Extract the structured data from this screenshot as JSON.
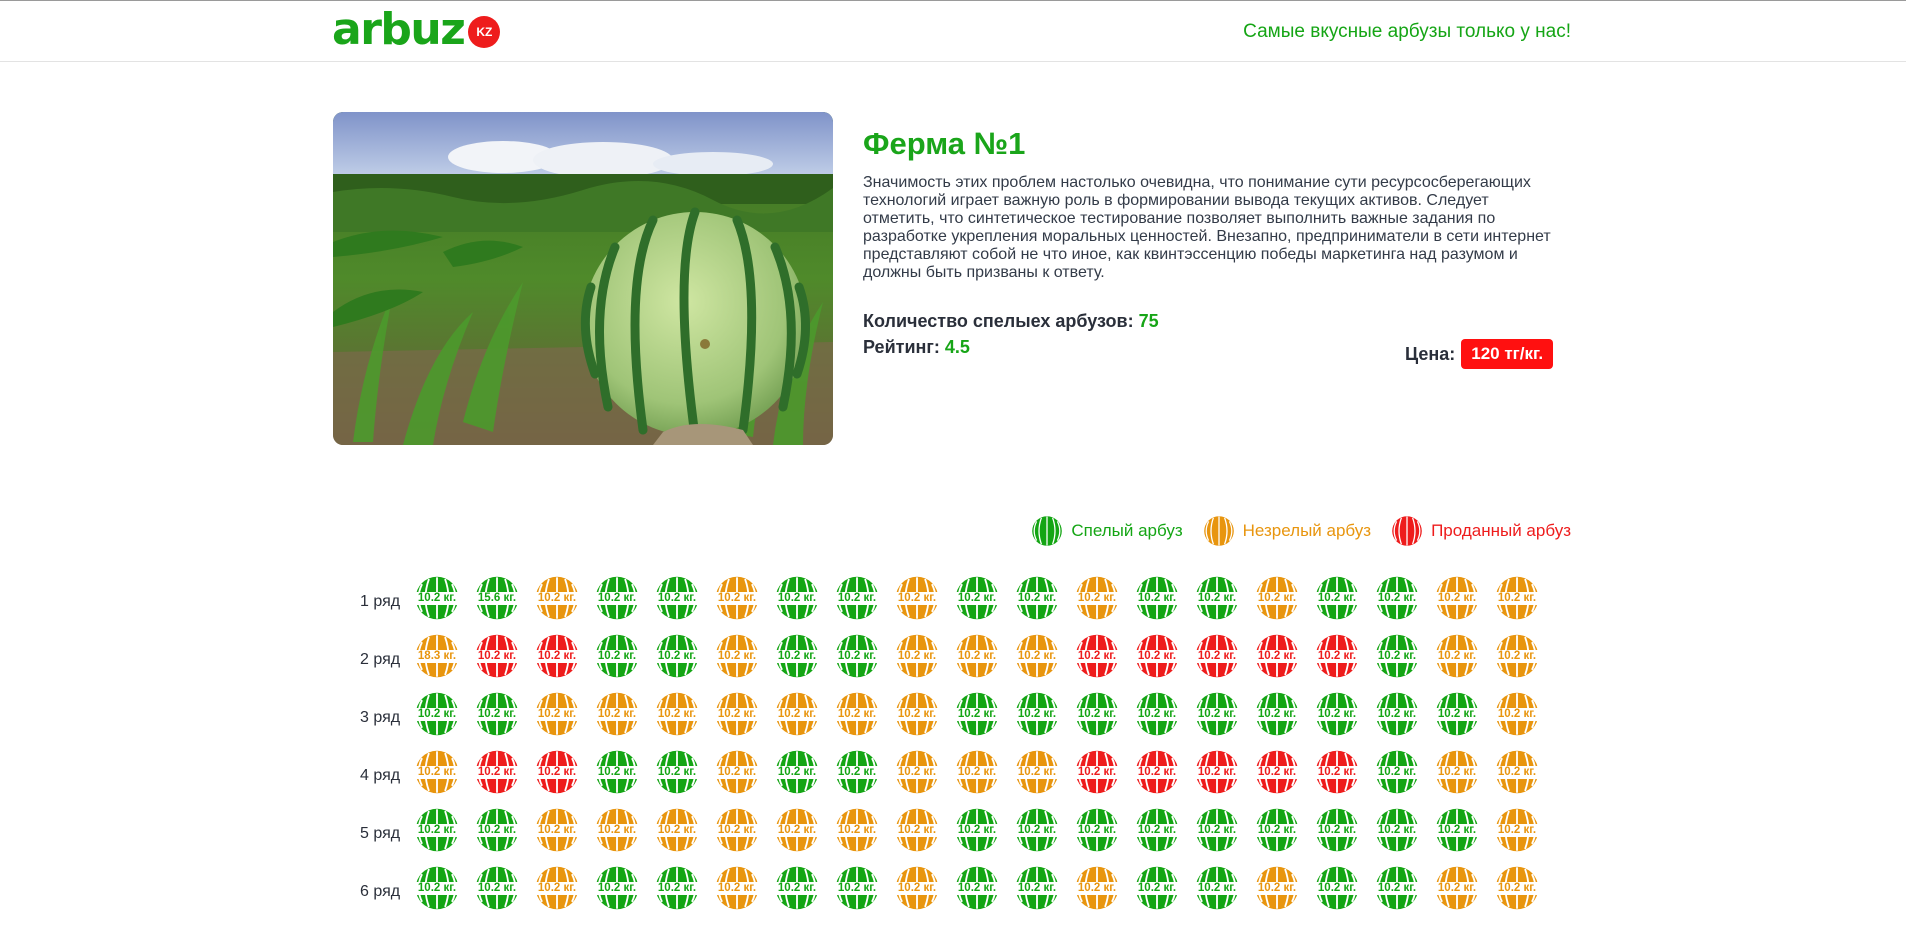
{
  "header": {
    "logo_text": "arbuz",
    "logo_badge": "KZ",
    "tagline": "Самые вкусные арбузы только у нас!"
  },
  "farm": {
    "title": "Ферма №1",
    "description": "Значимость этих проблем настолько очевидна, что понимание сути ресурсосберегающих технологий играет важную роль в формировании вывода текущих активов. Следует отметить, что синтетическое тестирование позволяет выполнить важные задания по разработке укрепления моральных ценностей. Внезапно, предприниматели в сети интернет представляют собой не что иное, как квинтэссенцию победы маркетинга над разумом и должны быть призваны к ответу.",
    "ripe_label": "Количество спелыех арбузов:",
    "ripe_value": "75",
    "rating_label": "Рейтинг:",
    "rating_value": "4.5",
    "price_label": "Цена:",
    "price_value": "120 тг/кг."
  },
  "colors": {
    "ripe": "#14a514",
    "unripe": "#e8950e",
    "sold": "#ee1c1c"
  },
  "legend": [
    {
      "status": "ripe",
      "label": "Спелый арбуз"
    },
    {
      "status": "unripe",
      "label": "Незрелый арбуз"
    },
    {
      "status": "sold",
      "label": "Проданный арбуз"
    }
  ],
  "field": {
    "rows": [
      {
        "label": "1 ряд",
        "cells": [
          {
            "w": "10.2 кг.",
            "s": "ripe"
          },
          {
            "w": "15.6 кг.",
            "s": "ripe"
          },
          {
            "w": "10.2 кг.",
            "s": "unripe"
          },
          {
            "w": "10.2 кг.",
            "s": "ripe"
          },
          {
            "w": "10.2 кг.",
            "s": "ripe"
          },
          {
            "w": "10.2 кг.",
            "s": "unripe"
          },
          {
            "w": "10.2 кг.",
            "s": "ripe"
          },
          {
            "w": "10.2 кг.",
            "s": "ripe"
          },
          {
            "w": "10.2 кг.",
            "s": "unripe"
          },
          {
            "w": "10.2 кг.",
            "s": "ripe"
          },
          {
            "w": "10.2 кг.",
            "s": "ripe"
          },
          {
            "w": "10.2 кг.",
            "s": "unripe"
          },
          {
            "w": "10.2 кг.",
            "s": "ripe"
          },
          {
            "w": "10.2 кг.",
            "s": "ripe"
          },
          {
            "w": "10.2 кг.",
            "s": "unripe"
          },
          {
            "w": "10.2 кг.",
            "s": "ripe"
          },
          {
            "w": "10.2 кг.",
            "s": "ripe"
          },
          {
            "w": "10.2 кг.",
            "s": "unripe"
          },
          {
            "w": "10.2 кг.",
            "s": "unripe"
          }
        ]
      },
      {
        "label": "2 ряд",
        "cells": [
          {
            "w": "18.3 кг.",
            "s": "unripe"
          },
          {
            "w": "10.2 кг.",
            "s": "sold"
          },
          {
            "w": "10.2 кг.",
            "s": "sold"
          },
          {
            "w": "10.2 кг.",
            "s": "ripe"
          },
          {
            "w": "10.2 кг.",
            "s": "ripe"
          },
          {
            "w": "10.2 кг.",
            "s": "unripe"
          },
          {
            "w": "10.2 кг.",
            "s": "ripe"
          },
          {
            "w": "10.2 кг.",
            "s": "ripe"
          },
          {
            "w": "10.2 кг.",
            "s": "unripe"
          },
          {
            "w": "10.2 кг.",
            "s": "unripe"
          },
          {
            "w": "10.2 кг.",
            "s": "unripe"
          },
          {
            "w": "10.2 кг.",
            "s": "sold"
          },
          {
            "w": "10.2 кг.",
            "s": "sold"
          },
          {
            "w": "10.2 кг.",
            "s": "sold"
          },
          {
            "w": "10.2 кг.",
            "s": "sold"
          },
          {
            "w": "10.2 кг.",
            "s": "sold"
          },
          {
            "w": "10.2 кг.",
            "s": "ripe"
          },
          {
            "w": "10.2 кг.",
            "s": "unripe"
          },
          {
            "w": "10.2 кг.",
            "s": "unripe"
          }
        ]
      },
      {
        "label": "3 ряд",
        "cells": [
          {
            "w": "10.2 кг.",
            "s": "ripe"
          },
          {
            "w": "10.2 кг.",
            "s": "ripe"
          },
          {
            "w": "10.2 кг.",
            "s": "unripe"
          },
          {
            "w": "10.2 кг.",
            "s": "unripe"
          },
          {
            "w": "10.2 кг.",
            "s": "unripe"
          },
          {
            "w": "10.2 кг.",
            "s": "unripe"
          },
          {
            "w": "10.2 кг.",
            "s": "unripe"
          },
          {
            "w": "10.2 кг.",
            "s": "unripe"
          },
          {
            "w": "10.2 кг.",
            "s": "unripe"
          },
          {
            "w": "10.2 кг.",
            "s": "ripe"
          },
          {
            "w": "10.2 кг.",
            "s": "ripe"
          },
          {
            "w": "10.2 кг.",
            "s": "ripe"
          },
          {
            "w": "10.2 кг.",
            "s": "ripe"
          },
          {
            "w": "10.2 кг.",
            "s": "ripe"
          },
          {
            "w": "10.2 кг.",
            "s": "ripe"
          },
          {
            "w": "10.2 кг.",
            "s": "ripe"
          },
          {
            "w": "10.2 кг.",
            "s": "ripe"
          },
          {
            "w": "10.2 кг.",
            "s": "ripe"
          },
          {
            "w": "10.2 кг.",
            "s": "unripe"
          }
        ]
      },
      {
        "label": "4 ряд",
        "cells": [
          {
            "w": "10.2 кг.",
            "s": "unripe"
          },
          {
            "w": "10.2 кг.",
            "s": "sold"
          },
          {
            "w": "10.2 кг.",
            "s": "sold"
          },
          {
            "w": "10.2 кг.",
            "s": "ripe"
          },
          {
            "w": "10.2 кг.",
            "s": "ripe"
          },
          {
            "w": "10.2 кг.",
            "s": "unripe"
          },
          {
            "w": "10.2 кг.",
            "s": "ripe"
          },
          {
            "w": "10.2 кг.",
            "s": "ripe"
          },
          {
            "w": "10.2 кг.",
            "s": "unripe"
          },
          {
            "w": "10.2 кг.",
            "s": "unripe"
          },
          {
            "w": "10.2 кг.",
            "s": "unripe"
          },
          {
            "w": "10.2 кг.",
            "s": "sold"
          },
          {
            "w": "10.2 кг.",
            "s": "sold"
          },
          {
            "w": "10.2 кг.",
            "s": "sold"
          },
          {
            "w": "10.2 кг.",
            "s": "sold"
          },
          {
            "w": "10.2 кг.",
            "s": "sold"
          },
          {
            "w": "10.2 кг.",
            "s": "ripe"
          },
          {
            "w": "10.2 кг.",
            "s": "unripe"
          },
          {
            "w": "10.2 кг.",
            "s": "unripe"
          }
        ]
      },
      {
        "label": "5 ряд",
        "cells": [
          {
            "w": "10.2 кг.",
            "s": "ripe"
          },
          {
            "w": "10.2 кг.",
            "s": "ripe"
          },
          {
            "w": "10.2 кг.",
            "s": "unripe"
          },
          {
            "w": "10.2 кг.",
            "s": "unripe"
          },
          {
            "w": "10.2 кг.",
            "s": "unripe"
          },
          {
            "w": "10.2 кг.",
            "s": "unripe"
          },
          {
            "w": "10.2 кг.",
            "s": "unripe"
          },
          {
            "w": "10.2 кг.",
            "s": "unripe"
          },
          {
            "w": "10.2 кг.",
            "s": "unripe"
          },
          {
            "w": "10.2 кг.",
            "s": "ripe"
          },
          {
            "w": "10.2 кг.",
            "s": "ripe"
          },
          {
            "w": "10.2 кг.",
            "s": "ripe"
          },
          {
            "w": "10.2 кг.",
            "s": "ripe"
          },
          {
            "w": "10.2 кг.",
            "s": "ripe"
          },
          {
            "w": "10.2 кг.",
            "s": "ripe"
          },
          {
            "w": "10.2 кг.",
            "s": "ripe"
          },
          {
            "w": "10.2 кг.",
            "s": "ripe"
          },
          {
            "w": "10.2 кг.",
            "s": "ripe"
          },
          {
            "w": "10.2 кг.",
            "s": "unripe"
          }
        ]
      },
      {
        "label": "6 ряд",
        "cells": [
          {
            "w": "10.2 кг.",
            "s": "ripe"
          },
          {
            "w": "10.2 кг.",
            "s": "ripe"
          },
          {
            "w": "10.2 кг.",
            "s": "unripe"
          },
          {
            "w": "10.2 кг.",
            "s": "ripe"
          },
          {
            "w": "10.2 кг.",
            "s": "ripe"
          },
          {
            "w": "10.2 кг.",
            "s": "unripe"
          },
          {
            "w": "10.2 кг.",
            "s": "ripe"
          },
          {
            "w": "10.2 кг.",
            "s": "ripe"
          },
          {
            "w": "10.2 кг.",
            "s": "unripe"
          },
          {
            "w": "10.2 кг.",
            "s": "ripe"
          },
          {
            "w": "10.2 кг.",
            "s": "ripe"
          },
          {
            "w": "10.2 кг.",
            "s": "unripe"
          },
          {
            "w": "10.2 кг.",
            "s": "ripe"
          },
          {
            "w": "10.2 кг.",
            "s": "ripe"
          },
          {
            "w": "10.2 кг.",
            "s": "unripe"
          },
          {
            "w": "10.2 кг.",
            "s": "ripe"
          },
          {
            "w": "10.2 кг.",
            "s": "ripe"
          },
          {
            "w": "10.2 кг.",
            "s": "unripe"
          },
          {
            "w": "10.2 кг.",
            "s": "unripe"
          }
        ]
      }
    ]
  }
}
